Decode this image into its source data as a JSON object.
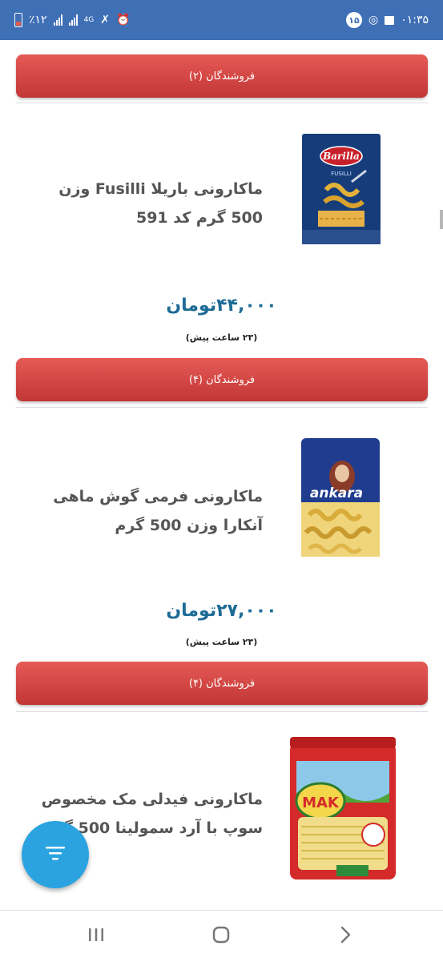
{
  "status_bar": {
    "time": "۰۱:۳۵",
    "notification_count": "۱۵",
    "network_type": "4G",
    "battery_percent": "٪۱۲"
  },
  "products": [
    {
      "vendors_label": "فروشندگان (۲)"
    },
    {
      "title": "ماکارونی باریلا Fusilli وزن 500 گرم کد 591",
      "price": "۴۴,۰۰۰تومان",
      "time_ago": "(۲۳ ساعت پیش)",
      "vendors_label": "فروشندگان (۴)",
      "image": {
        "brand": "Barilla",
        "variety": "FUSILLI"
      }
    },
    {
      "title": "ماکارونی فرمی گوش ماهی آنکارا وزن 500 گرم",
      "price": "۲۷,۰۰۰تومان",
      "time_ago": "(۲۳ ساعت پیش)",
      "vendors_label": "فروشندگان (۴)",
      "image": {
        "brand": "ankara"
      }
    },
    {
      "title": "ماکارونی فیدلی مک مخصوص سوپ با آرد سمولینا 500 گرم",
      "image": {
        "brand": "MAK"
      }
    }
  ],
  "fab": {
    "icon": "filter-icon"
  },
  "nav_bar": {
    "icons": [
      "recents-icon",
      "home-icon",
      "back-icon"
    ]
  },
  "colors": {
    "status_bar": "#3f6fb5",
    "vendors_button": "#d9443f",
    "price": "#1e6c96",
    "fab": "#2aa3e0"
  }
}
